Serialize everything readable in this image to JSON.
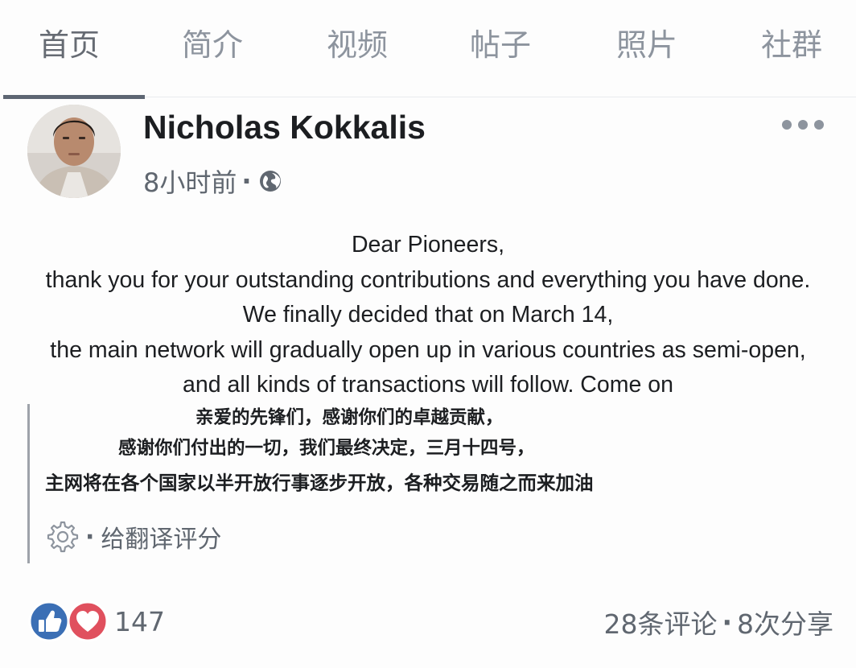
{
  "tabs": [
    {
      "label": "首页"
    },
    {
      "label": "简介"
    },
    {
      "label": "视频"
    },
    {
      "label": "帖子"
    },
    {
      "label": "照片"
    },
    {
      "label": "社群"
    }
  ],
  "post": {
    "author": "Nicholas Kokkalis",
    "time": "8小时前",
    "separator": "·",
    "privacy_icon": "globe-icon",
    "menu_icon": "more-horizontal-icon",
    "text_en": [
      "Dear Pioneers,",
      "thank you for your outstanding contributions and everything you have done.",
      "We finally decided that on March 14,",
      "the main network will gradually open up in various countries as semi-open,",
      "and all kinds of transactions will follow. Come on"
    ],
    "text_zh": [
      "亲爱的先锋们，感谢你们的卓越贡献，",
      "感谢你们付出的一切，我们最终决定，三月十四号，",
      "主网将在各个国家以半开放行事逐步开放，各种交易随之而来加油"
    ],
    "rate_translation": {
      "icon": "gear-icon",
      "separator": "·",
      "label": "给翻译评分"
    }
  },
  "footer": {
    "reaction_icons": [
      "like-icon",
      "love-icon"
    ],
    "reaction_count": "147",
    "comments": "28条评论",
    "separator": "·",
    "shares": "8次分享"
  },
  "colors": {
    "primary_text": "#1c1e21",
    "secondary_text": "#606770",
    "like_blue": "#3b6fb5",
    "love_red": "#e0505e"
  }
}
